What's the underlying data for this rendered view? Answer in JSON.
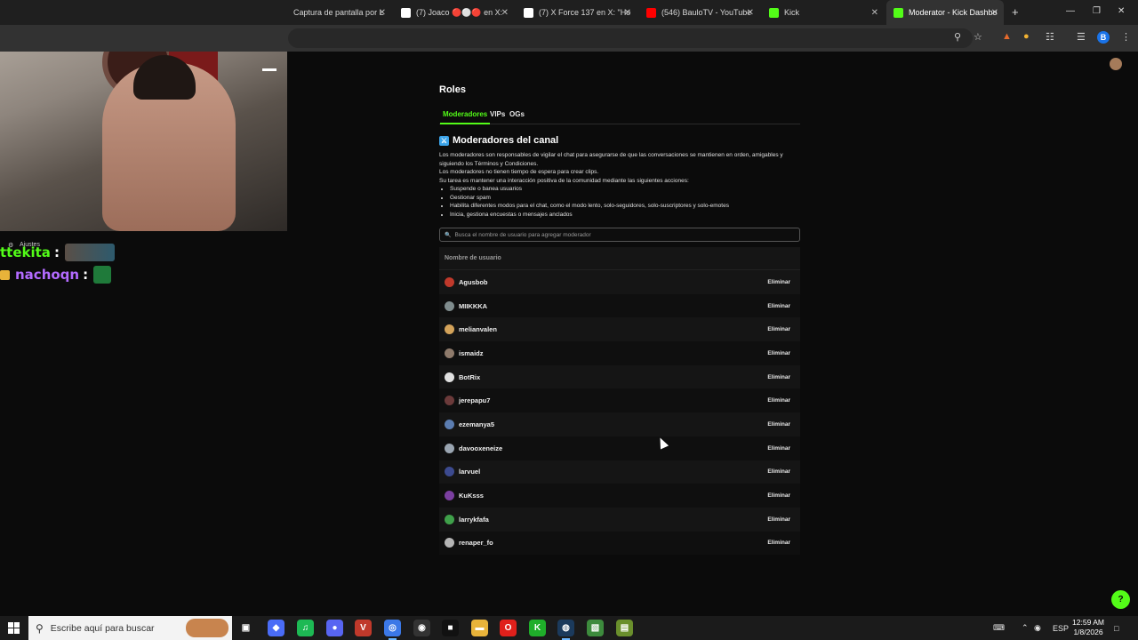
{
  "browser": {
    "tabs": [
      {
        "title": "Captura de pantalla por L",
        "favicon": "image-icon",
        "favcolor": "#ffffff"
      },
      {
        "title": "(7) Joaco 🔴⚪🔴 en X:",
        "favicon": "x-icon",
        "favcolor": "#ffffff"
      },
      {
        "title": "(7) X Force 137 en X: \"Ho",
        "favicon": "x-icon",
        "favcolor": "#ffffff"
      },
      {
        "title": "(546) BauloTV - YouTube",
        "favicon": "youtube-icon",
        "favcolor": "#ff0000"
      },
      {
        "title": "Kick",
        "favicon": "kick-icon",
        "favcolor": "#53fc18"
      },
      {
        "title": "Moderator - Kick Dashbo",
        "favicon": "kick-icon",
        "favcolor": "#53fc18"
      }
    ],
    "profile_letter": "B"
  },
  "chat": {
    "settings_label": "Ajustes",
    "messages": [
      {
        "user": "ttekita",
        "color": "#53fc18"
      },
      {
        "user": "nachoqn",
        "color": "#b36bff"
      }
    ]
  },
  "page": {
    "title": "Roles",
    "tabs": [
      "Moderadores",
      "VIPs",
      "OGs"
    ],
    "section_title": "Moderadores del canal",
    "description_lines": [
      "Los moderadores son responsables de vigilar el chat para asegurarse de que las conversaciones se mantienen en orden, amigables y siguiendo los Términos y Condiciones.",
      "Los moderadores no tienen tiempo de espera para crear clips.",
      "Su tarea es mantener una interacción positiva de la comunidad mediante las siguientes acciones:"
    ],
    "bullets": [
      "Suspende o banea usuarios",
      "Gestionar spam",
      "Habilita diferentes modos para el chat, como el modo lento, solo-seguidores, solo-suscriptores y solo-emotes",
      "Inicia, gestiona encuestas o mensajes anclados"
    ],
    "search_placeholder": "Busca el nombre de usuario para agregar moderador",
    "column_header": "Nombre de usuario",
    "remove_label": "Eliminar",
    "moderators": [
      {
        "name": "Agusbob",
        "avatar_color": "#c0392b"
      },
      {
        "name": "MIIKKKA",
        "avatar_color": "#7f8c8d"
      },
      {
        "name": "melianvalen",
        "avatar_color": "#d4a35a"
      },
      {
        "name": "ismaidz",
        "avatar_color": "#8e7a6b"
      },
      {
        "name": "BotRix",
        "avatar_color": "#e0e0e0"
      },
      {
        "name": "jerepapu7",
        "avatar_color": "#6b3a3a"
      },
      {
        "name": "ezemanya5",
        "avatar_color": "#5b7db1"
      },
      {
        "name": "davooxeneize",
        "avatar_color": "#9aa5b1"
      },
      {
        "name": "larvuel",
        "avatar_color": "#3c4a8f"
      },
      {
        "name": "KuKsss",
        "avatar_color": "#7b3fa0"
      },
      {
        "name": "larrykfafa",
        "avatar_color": "#3fa04a"
      },
      {
        "name": "renaper_fo",
        "avatar_color": "#b5b5b5"
      }
    ]
  },
  "taskbar": {
    "search_placeholder": "Escribe aquí para buscar",
    "language": "ESP",
    "time": "12:59 AM",
    "date": "1/8/2026",
    "apps": [
      {
        "name": "task-view-icon",
        "color": "#1b1b1b",
        "glyph": "▣"
      },
      {
        "name": "copilot-icon",
        "color": "#4a6cf7",
        "glyph": "◆"
      },
      {
        "name": "spotify-icon",
        "color": "#1db954",
        "glyph": "♫"
      },
      {
        "name": "discord-icon",
        "color": "#5865f2",
        "glyph": "●"
      },
      {
        "name": "voicemeeter-icon",
        "color": "#c0392b",
        "glyph": "V"
      },
      {
        "name": "chrome-icon",
        "color": "#3b78e7",
        "glyph": "◎"
      },
      {
        "name": "obs-icon",
        "color": "#333333",
        "glyph": "◉"
      },
      {
        "name": "capcut-icon",
        "color": "#111111",
        "glyph": "■"
      },
      {
        "name": "file-explorer-icon",
        "color": "#e8b33a",
        "glyph": "▬"
      },
      {
        "name": "opera-icon",
        "color": "#e0201b",
        "glyph": "O"
      },
      {
        "name": "kick-icon",
        "color": "#1fae2a",
        "glyph": "K"
      },
      {
        "name": "steam-icon",
        "color": "#1b3a5c",
        "glyph": "◍"
      },
      {
        "name": "minecraft-icon",
        "color": "#3d8b3d",
        "glyph": "▧"
      },
      {
        "name": "game-icon",
        "color": "#6a8f2c",
        "glyph": "▤"
      }
    ]
  }
}
